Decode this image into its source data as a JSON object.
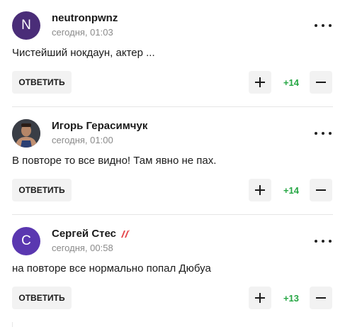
{
  "colors": {
    "score_positive": "#27a745",
    "avatar_n": "#4a2d78",
    "avatar_c": "#5a37b0",
    "badge": "#e5484d"
  },
  "comments": [
    {
      "author": "neutronpwnz",
      "avatar_letter": "N",
      "avatar_type": "letter",
      "date": "сегодня, 01:03",
      "text": "Чистейший нокдаун, актер ...",
      "reply_label": "ОТВЕТИТЬ",
      "score": "+14",
      "more_icon": "more-dots-icon"
    },
    {
      "author": "Игорь Герасимчук",
      "avatar_type": "photo",
      "date": "сегодня, 01:00",
      "text": "В повторе то все видно! Там явно не пах.",
      "reply_label": "ОТВЕТИТЬ",
      "score": "+14",
      "more_icon": "more-dots-icon"
    },
    {
      "author": "Сергей Стес",
      "avatar_letter": "C",
      "avatar_type": "letter",
      "date": "сегодня, 00:58",
      "text": "на повторе все нормально попал Дюбуа",
      "reply_label": "ОТВЕТИТЬ",
      "score": "+13",
      "badge_icon": "red-badge-icon",
      "more_icon": "more-dots-icon"
    }
  ]
}
